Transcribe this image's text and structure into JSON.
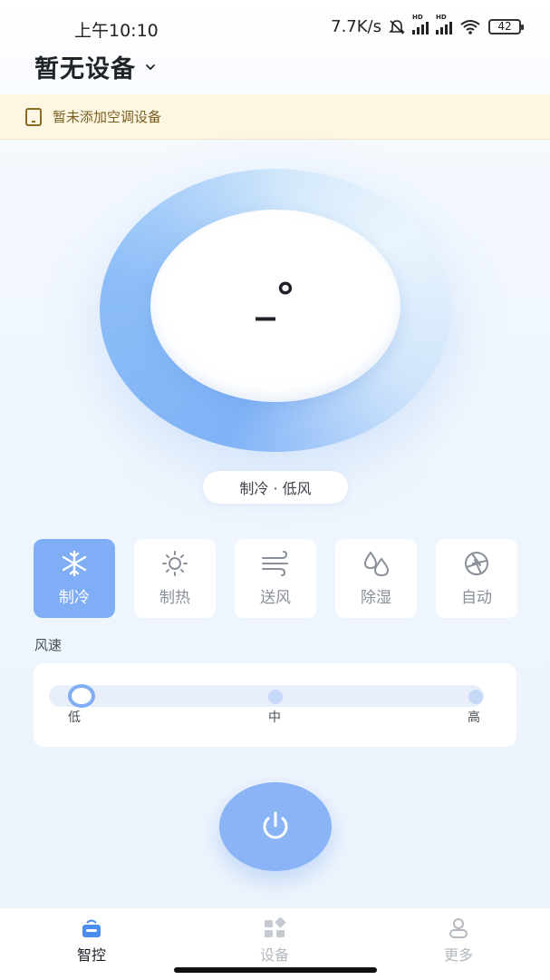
{
  "status_bar": {
    "time": "上午10:10",
    "net_speed": "7.7K/s",
    "battery": "42",
    "hd_label": "HD"
  },
  "header": {
    "title": "暂无设备"
  },
  "notice": {
    "text": "暂未添加空调设备"
  },
  "dial": {
    "temperature": "_°",
    "mode_summary": "制冷 · 低风"
  },
  "modes": [
    {
      "label": "制冷",
      "icon": "snowflake-icon",
      "active": true
    },
    {
      "label": "制热",
      "icon": "sun-icon",
      "active": false
    },
    {
      "label": "送风",
      "icon": "wind-icon",
      "active": false
    },
    {
      "label": "除湿",
      "icon": "droplets-icon",
      "active": false
    },
    {
      "label": "自动",
      "icon": "aperture-icon",
      "active": false
    }
  ],
  "fan_speed": {
    "label": "风速",
    "levels": [
      "低",
      "中",
      "高"
    ],
    "selected": "低"
  },
  "power": {
    "icon": "power-icon"
  },
  "tabs": [
    {
      "label": "智控",
      "icon": "remote-icon",
      "active": true
    },
    {
      "label": "设备",
      "icon": "grid-icon",
      "active": false
    },
    {
      "label": "更多",
      "icon": "user-icon",
      "active": false
    }
  ],
  "colors": {
    "accent": "#7fadf6",
    "notice_bg": "#fdf6e3",
    "notice_text": "#7a6020"
  }
}
